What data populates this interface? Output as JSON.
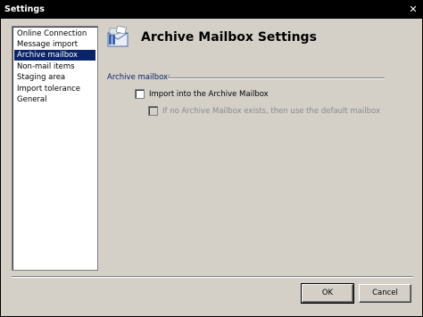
{
  "window": {
    "title": "Settings"
  },
  "nav": {
    "items": [
      {
        "label": "Online Connection",
        "selected": false
      },
      {
        "label": "Message import",
        "selected": false
      },
      {
        "label": "Archive mailbox",
        "selected": true
      },
      {
        "label": "Non-mail items",
        "selected": false
      },
      {
        "label": "Staging area",
        "selected": false
      },
      {
        "label": "Import tolerance",
        "selected": false
      },
      {
        "label": "General",
        "selected": false
      }
    ]
  },
  "page": {
    "title": "Archive Mailbox Settings",
    "icon": "archive-mailbox-icon",
    "section_label": "Archive mailbox:",
    "options": [
      {
        "label": "Import into the Archive Mailbox",
        "checked": false,
        "enabled": true
      },
      {
        "label": "If no Archive Mailbox exists, then use the default mailbox",
        "checked": false,
        "enabled": false
      }
    ]
  },
  "buttons": {
    "ok": "OK",
    "cancel": "Cancel"
  },
  "colors": {
    "selection": "#0a246a",
    "dialog_bg": "#d4d0c8",
    "titlebar": "#000000"
  }
}
